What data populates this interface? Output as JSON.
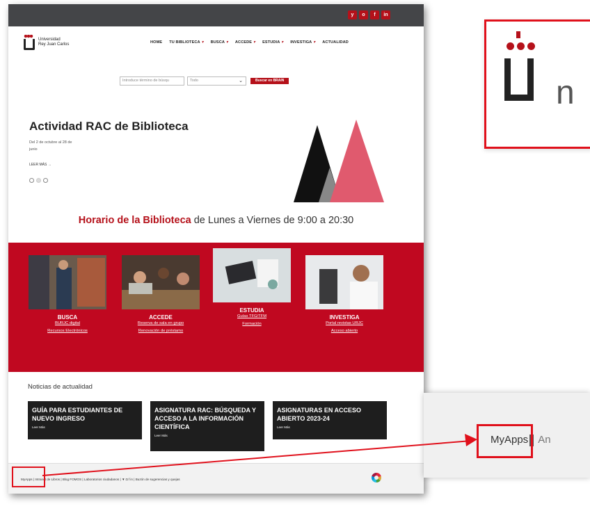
{
  "social_icons": [
    "y",
    "o",
    "f",
    "in"
  ],
  "brand": {
    "line1": "Universidad",
    "line2": "Rey Juan Carlos"
  },
  "nav": {
    "items": [
      {
        "label": "HOME",
        "caret": ""
      },
      {
        "label": "TU BIBLIOTECA",
        "caret": "▾"
      },
      {
        "label": "BUSCA",
        "caret": "▾"
      },
      {
        "label": "ACCEDE",
        "caret": "▾"
      },
      {
        "label": "ESTUDIA",
        "caret": "▾"
      },
      {
        "label": "INVESTIGA",
        "caret": "▾"
      },
      {
        "label": "ACTUALIDAD",
        "caret": ""
      }
    ]
  },
  "search": {
    "placeholder": "Introduce término de búsqu",
    "filter": "Todo",
    "button": "Buscar en BRAIN"
  },
  "hero": {
    "title": "Actividad RAC de Biblioteca",
    "dates": "Del 2 de octubre al 28 de junio",
    "more": "LEER MÁS →"
  },
  "hours": {
    "highlight": "Horario de la Biblioteca",
    "rest": " de Lunes a Viernes de 9:00 a 20:30"
  },
  "cards": [
    {
      "category": "BUSCA",
      "links": [
        "BURJC digital",
        "Recursos Electrónicos"
      ]
    },
    {
      "category": "ACCEDE",
      "links": [
        "Reserva de sala en grupo",
        "Renovación de préstamo"
      ]
    },
    {
      "category": "ESTUDIA",
      "links": [
        "Guías TFG/TFM",
        "Formación"
      ]
    },
    {
      "category": "INVESTIGA",
      "links": [
        "Portal revistas URJC",
        "Acceso abierto"
      ]
    }
  ],
  "news": {
    "heading": "Noticias de actualidad",
    "items": [
      {
        "title": "GUÍA PARA ESTUDIANTES DE NUEVO INGRESO",
        "more": "Leer Más"
      },
      {
        "title": "ASIGNATURA RAC: BÚSQUEDA Y ACCESO A LA INFORMACIÓN CIENTÍFICA",
        "more": "Leer Más"
      },
      {
        "title": "ASIGNATURAS EN ACCESO ABIERTO 2023-24",
        "more": "Leer Más"
      }
    ]
  },
  "footer": {
    "links": "MyApps  |  Intranet de Libros  |  Blog FOMOS  |  Laboratorios ciudadanos  |  ▼  ◘  f  in  |  Buzón de sugerencias y quejas"
  },
  "zoom": {
    "logo_letter": "n",
    "footer_first": "MyApps",
    "footer_rest": "An"
  },
  "colors": {
    "brand_red": "#b5111a",
    "highlight_red": "#e0101b",
    "band_red": "#c00820"
  }
}
